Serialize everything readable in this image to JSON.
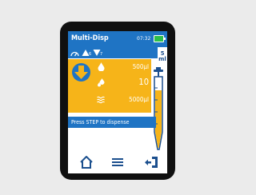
{
  "device": {
    "app_title": "Multi-Disp",
    "clock": "07:32",
    "battery_icon": "battery-icon",
    "battery_color": "#2dbf4a"
  },
  "params": {
    "speed_icon": "speed-gauge-icon",
    "aspirate_icon": "aspirate-speed-icon",
    "aspirate_value": "6",
    "dispense_icon": "dispense-speed-icon",
    "dispense_value": "7"
  },
  "volume": {
    "value": "5",
    "unit": "ml"
  },
  "panel": {
    "mode_icon": "dispense-down-arrow-icon",
    "rows": [
      {
        "icon": "drop-icon",
        "value": "500µl"
      },
      {
        "icon": "multiple-drops-icon",
        "value": "10"
      },
      {
        "icon": "waves-icon",
        "value": "5000µl"
      }
    ]
  },
  "prompt": "Press STEP to dispense",
  "nav": {
    "home_icon": "home-icon",
    "menu_icon": "menu-icon",
    "eject_icon": "eject-tip-icon"
  },
  "colors": {
    "accent": "#1f74c4",
    "panel": "#f6b419",
    "bezel": "#101010",
    "background": "#ebebeb"
  }
}
